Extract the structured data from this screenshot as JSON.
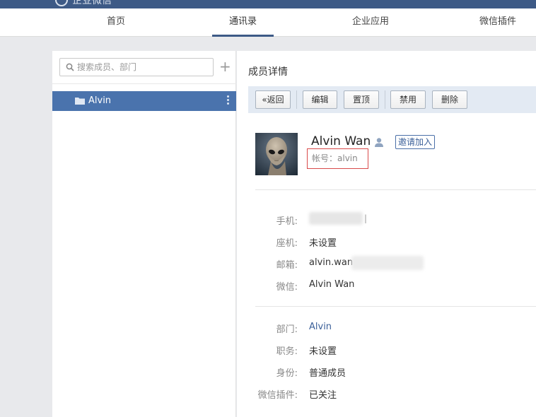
{
  "app": {
    "title": "企业微信"
  },
  "nav": {
    "items": [
      {
        "label": "首页"
      },
      {
        "label": "通讯录"
      },
      {
        "label": "企业应用"
      },
      {
        "label": "微信插件"
      }
    ]
  },
  "sidebar": {
    "search_placeholder": "搜索成员、部门",
    "add_symbol": "+",
    "tree": [
      {
        "label": "Alvin"
      }
    ]
  },
  "main": {
    "title": "成员详情",
    "toolbar": {
      "back": "返回",
      "edit": "编辑",
      "pin": "置顶",
      "disable": "禁用",
      "delete": "删除"
    },
    "profile": {
      "name": "Alvin Wan",
      "invite": "邀请加入",
      "account_label": "帐号：",
      "account_value": "alvin"
    },
    "contact": {
      "phone_label": "手机:",
      "landline_label": "座机:",
      "landline_value": "未设置",
      "email_label": "邮箱:",
      "email_value": "alvin.wan",
      "wechat_label": "微信:",
      "wechat_value": "Alvin Wan"
    },
    "org": {
      "dept_label": "部门:",
      "dept_value": "Alvin",
      "position_label": "职务:",
      "position_value": "未设置",
      "identity_label": "身份:",
      "identity_value": "普通成员",
      "plugin_label": "微信插件:",
      "plugin_value": "已关注"
    }
  },
  "colors": {
    "topbar": "#3d5a86",
    "selected_row": "#4a73ad",
    "toolbar_bg": "#e3eaf3",
    "link": "#3a5f98",
    "highlight_border": "#d94a4a"
  }
}
